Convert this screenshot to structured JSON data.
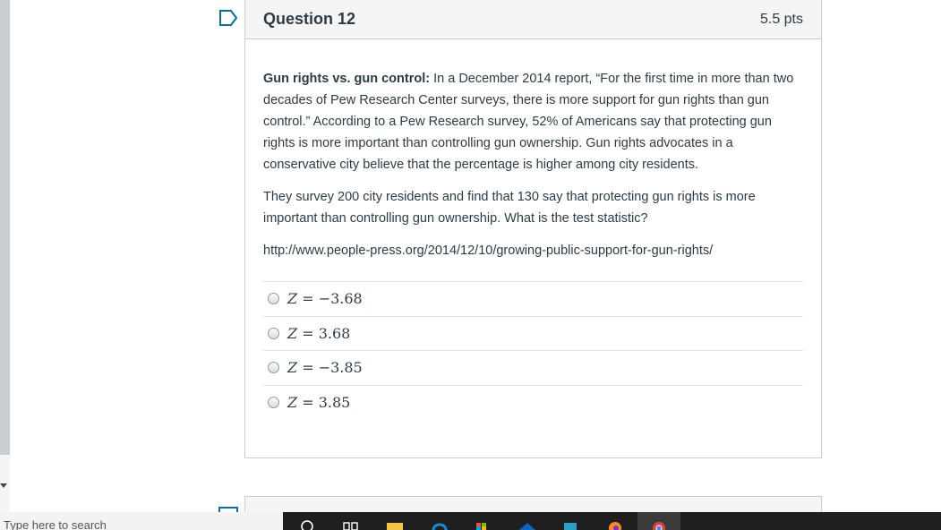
{
  "question": {
    "title": "Question 12",
    "points": "5.5 pts",
    "intro_bold": "Gun rights vs. gun control:",
    "intro_text": " In a December 2014 report, “For the first time in more than two decades of Pew Research Center surveys, there is more support for gun rights than gun control.” According to a Pew Research survey, 52% of Americans say that protecting gun rights is more important than controlling gun ownership. Gun rights advocates in a conservative city believe that the percentage is higher among city residents.",
    "para2": "They survey 200 city residents and find that 130 say that protecting gun rights is more important than controlling gun ownership. What is the test statistic?",
    "url": "http://www.people-press.org/2014/12/10/growing-public-support-for-gun-rights/",
    "answers": [
      {
        "var": "Z",
        "eq": " = ",
        "value": "−3.68"
      },
      {
        "var": "Z",
        "eq": " = ",
        "value": "3.68"
      },
      {
        "var": "Z",
        "eq": " = ",
        "value": "−3.85"
      },
      {
        "var": "Z",
        "eq": " = ",
        "value": "3.85"
      }
    ]
  },
  "taskbar": {
    "search_placeholder": "Type here to search"
  },
  "colors": {
    "accent": "#0770a3",
    "text": "#2d3b45",
    "border": "#c7cdd1"
  }
}
